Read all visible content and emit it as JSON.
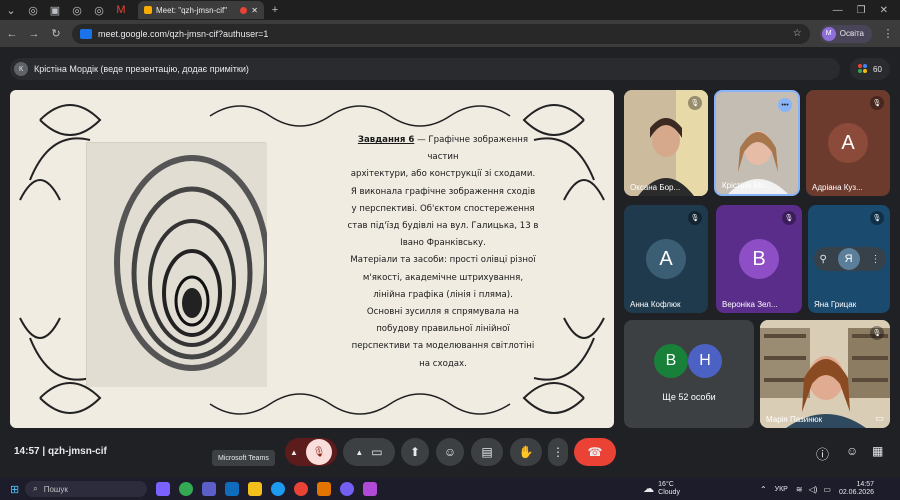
{
  "browser": {
    "active_tab_title": "Meet: \"qzh-jmsn-cif\"",
    "url": "meet.google.com/qzh-jmsn-cif?authuser=1",
    "profile_initial": "M",
    "profile_label": "Освіта"
  },
  "presenter": {
    "initial": "К",
    "text": "Крістіна Мордік (веде презентацію, додає примітки)"
  },
  "participants_count": "60",
  "slide": {
    "title": "Завдання 6",
    "lines": [
      "— Графічне зображення",
      "частин",
      "архітектури, або конструкції зі сходами.",
      "Я виконала графічне зображення сходів",
      "у перспективі. Об'єктом спостереження",
      "став під'їзд будівлі на вул. Галицька, 13 в",
      "Івано Франківську.",
      "Матеріали та засоби: прості олівці різної",
      "м'якості, академічне штрихування,",
      "лінійна графіка (лінія і пляма).",
      "Основні зусилля я спрямувала на",
      "побудову правильної лінійної",
      "перспективи та моделювання світлотіні",
      "на сходах."
    ]
  },
  "tiles": [
    {
      "name": "Оксана Бор...",
      "type": "video"
    },
    {
      "name": "Крістіна Мо...",
      "type": "video"
    },
    {
      "name": "Адріана Куз...",
      "initial": "А",
      "color": "#6d3b2e",
      "avatar": "#8b4a3a"
    },
    {
      "name": "Анна Кофлюк",
      "initial": "А",
      "color": "#1f3a4d",
      "avatar": "#3c5e74"
    },
    {
      "name": "Вероніка Зел...",
      "initial": "В",
      "color": "#5a2d8a",
      "avatar": "#8e4ec6"
    },
    {
      "name": "Яна Грицак",
      "initial": "Я",
      "color": "#1a4a6e",
      "avatar": "#5b7e9a"
    },
    {
      "name": "Ще 52 особи",
      "initials": [
        "В",
        "Н"
      ]
    },
    {
      "name": "Марія Пазинюк",
      "type": "video"
    }
  ],
  "bottom": {
    "time": "14:57",
    "meeting_code": "qzh-jmsn-cif",
    "tooltip": "Microsoft Teams"
  },
  "taskbar": {
    "search_label": "Пошук",
    "weather_temp": "16°C",
    "weather_desc": "Cloudy",
    "lang": "УКР",
    "time": "14:57",
    "date": "02.06.2026"
  }
}
